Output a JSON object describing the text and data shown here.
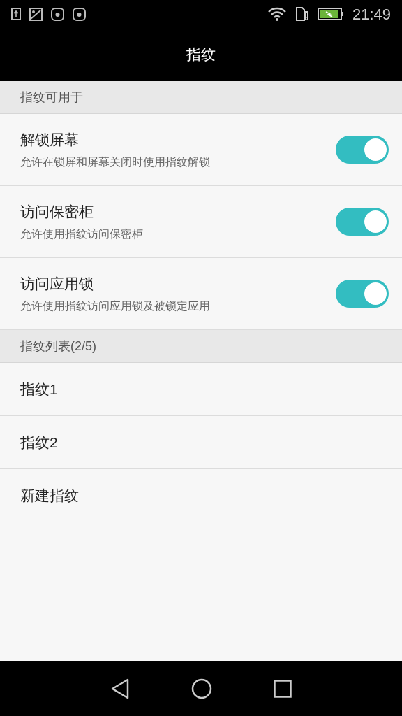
{
  "status_bar": {
    "time": "21:49"
  },
  "title": "指纹",
  "sections": [
    {
      "header": "指纹可用于",
      "items": [
        {
          "kind": "toggle",
          "title": "解锁屏幕",
          "subtitle": "允许在锁屏和屏幕关闭时使用指纹解锁",
          "on": true
        },
        {
          "kind": "toggle",
          "title": "访问保密柜",
          "subtitle": "允许使用指纹访问保密柜",
          "on": true
        },
        {
          "kind": "toggle",
          "title": "访问应用锁",
          "subtitle": "允许使用指纹访问应用锁及被锁定应用",
          "on": true
        }
      ]
    },
    {
      "header": "指纹列表(2/5)",
      "items": [
        {
          "kind": "link",
          "title": "指纹1"
        },
        {
          "kind": "link",
          "title": "指纹2"
        },
        {
          "kind": "link",
          "title": "新建指纹"
        }
      ]
    }
  ]
}
